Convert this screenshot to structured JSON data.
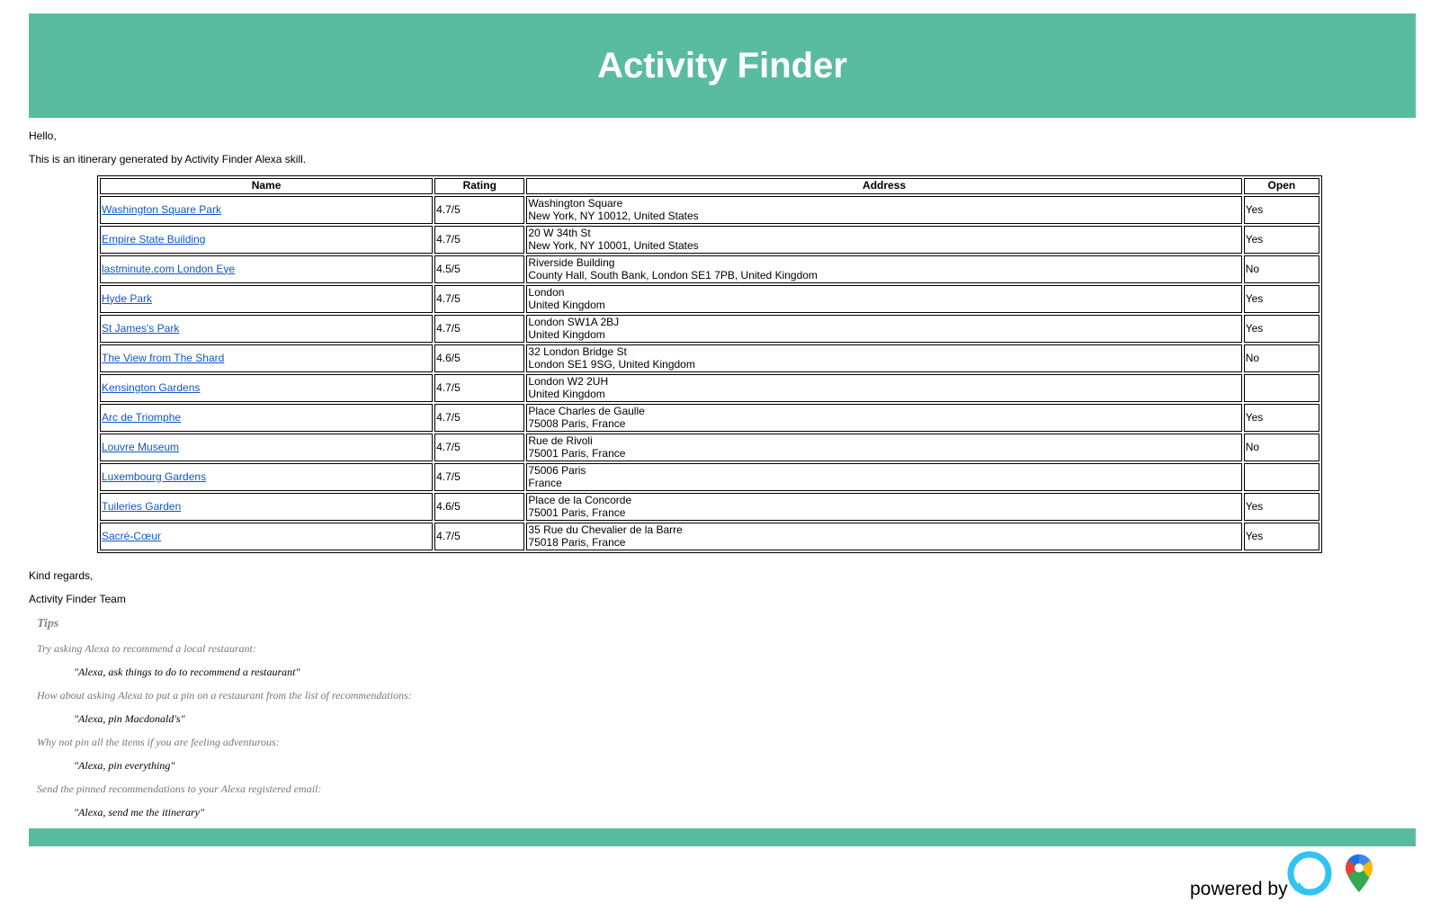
{
  "header": {
    "title": "Activity Finder",
    "color": "#5abc9e"
  },
  "greeting": "Hello,",
  "intro": "This is an itinerary generated by Activity Finder Alexa skill.",
  "table": {
    "headers": [
      "Name",
      "Rating",
      "Address",
      "Open"
    ],
    "rows": [
      {
        "name": "Washington Square Park",
        "rating": "4.7/5",
        "address1": "Washington Square",
        "address2": "New York, NY 10012, United States",
        "open": "Yes"
      },
      {
        "name": "Empire State Building",
        "rating": "4.7/5",
        "address1": "20 W 34th St",
        "address2": "New York, NY 10001, United States",
        "open": "Yes"
      },
      {
        "name": "lastminute.com London Eye",
        "rating": "4.5/5",
        "address1": "Riverside Building",
        "address2": "County Hall, South Bank, London SE1 7PB, United Kingdom",
        "open": "No"
      },
      {
        "name": "Hyde Park",
        "rating": "4.7/5",
        "address1": "London",
        "address2": "United Kingdom",
        "open": "Yes"
      },
      {
        "name": "St James's Park",
        "rating": "4.7/5",
        "address1": "London SW1A 2BJ",
        "address2": "United Kingdom",
        "open": "Yes"
      },
      {
        "name": "The View from The Shard",
        "rating": "4.6/5",
        "address1": "32 London Bridge St",
        "address2": "London SE1 9SG, United Kingdom",
        "open": "No"
      },
      {
        "name": "Kensington Gardens",
        "rating": "4.7/5",
        "address1": "London W2 2UH",
        "address2": "United Kingdom",
        "open": ""
      },
      {
        "name": "Arc de Triomphe",
        "rating": "4.7/5",
        "address1": "Place Charles de Gaulle",
        "address2": "75008 Paris, France",
        "open": "Yes"
      },
      {
        "name": "Louvre Museum",
        "rating": "4.7/5",
        "address1": "Rue de Rivoli",
        "address2": "75001 Paris, France",
        "open": "No"
      },
      {
        "name": "Luxembourg Gardens",
        "rating": "4.7/5",
        "address1": "75006 Paris",
        "address2": "France",
        "open": ""
      },
      {
        "name": "Tuileries Garden",
        "rating": "4.6/5",
        "address1": "Place de la Concorde",
        "address2": "75001 Paris, France",
        "open": "Yes"
      },
      {
        "name": "Sacré-Cœur",
        "rating": "4.7/5",
        "address1": "35 Rue du Chevalier de la Barre",
        "address2": "75018 Paris, France",
        "open": "Yes"
      }
    ]
  },
  "closing": {
    "line1": "Kind regards,",
    "line2": "Activity Finder Team"
  },
  "tips": {
    "title": "Tips",
    "items": [
      {
        "question": "Try asking Alexa to recommend a local restaurant:",
        "example": "\"Alexa, ask things to do to recommend a restaurant\""
      },
      {
        "question": "How about asking Alexa to put a pin on a restaurant from the list of recommendations:",
        "example": "\"Alexa, pin Macdonald's\""
      },
      {
        "question": "Why not pin all the items if you are feeling adventurous:",
        "example": "\"Alexa, pin everything\""
      },
      {
        "question": "Send the pinned recommendations to your Alexa registered email:",
        "example": "\"Alexa, send me the itinerary\""
      }
    ]
  },
  "footer": {
    "powered_by": "powered by",
    "icons": [
      "alexa-icon",
      "google-maps-icon"
    ]
  }
}
